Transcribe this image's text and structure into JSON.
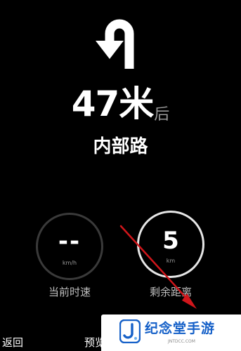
{
  "maneuver": {
    "icon": "u-turn-icon",
    "distance_value": "47米",
    "distance_suffix": "后",
    "road_name": "内部路"
  },
  "speed": {
    "value": "--",
    "unit": "km/h",
    "label": "当前时速"
  },
  "remaining": {
    "value": "5",
    "unit": "km",
    "label": "剩余距离"
  },
  "bottom_bar": {
    "back_label": "返回",
    "preview_label": "预览"
  },
  "watermark": {
    "brand": "纪念堂手游",
    "domain": "JNTDCC.COM"
  },
  "colors": {
    "background": "#000000",
    "primary_text": "#ffffff",
    "secondary_text": "#9a9a9a",
    "speed_ring": "#3a3a3a",
    "remaining_ring": "#e6e6e6",
    "annotation_red": "#d0161b",
    "watermark_blue": "#1560c8"
  }
}
